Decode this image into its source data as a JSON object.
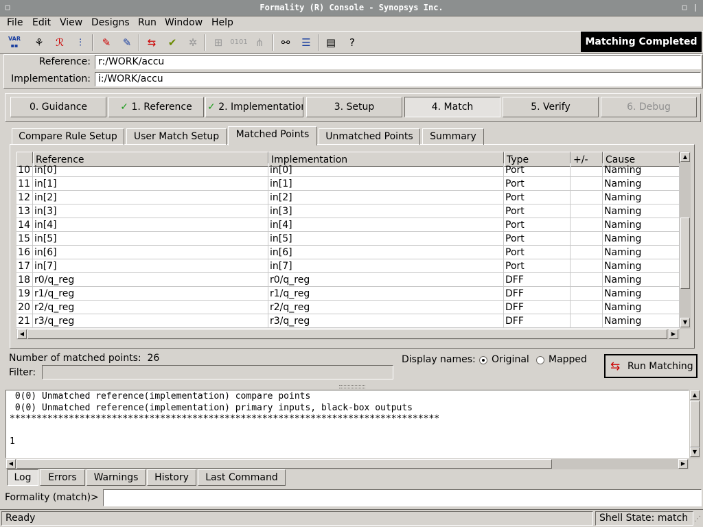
{
  "window": {
    "title": "Formality (R) Console - Synopsys Inc."
  },
  "menu": [
    "File",
    "Edit",
    "View",
    "Designs",
    "Run",
    "Window",
    "Help"
  ],
  "toolbar": {
    "icons": [
      "var-icon",
      "ref-tree-icon",
      "ref-design-icon",
      "impl-tree-icon",
      "erase-ref-icon",
      "erase-impl-icon",
      "match-icon",
      "verify-icon",
      "debug-icon",
      "schematic-icon",
      "binary-icon",
      "cone-icon",
      "find-icon",
      "list-icon",
      "report-icon",
      "help-icon"
    ],
    "var_label": "VAR",
    "status": "Matching Completed"
  },
  "fields": {
    "reference_label": "Reference:",
    "reference_value": "r:/WORK/accu",
    "implementation_label": "Implementation:",
    "implementation_value": "i:/WORK/accu"
  },
  "steps": [
    {
      "label": "0. Guidance",
      "state": "normal"
    },
    {
      "label": "1. Reference",
      "state": "done"
    },
    {
      "label": "2. Implementation",
      "state": "done"
    },
    {
      "label": "3. Setup",
      "state": "normal"
    },
    {
      "label": "4. Match",
      "state": "active"
    },
    {
      "label": "5. Verify",
      "state": "normal"
    },
    {
      "label": "6. Debug",
      "state": "disabled"
    }
  ],
  "tabs": [
    "Compare Rule Setup",
    "User Match Setup",
    "Matched Points",
    "Unmatched Points",
    "Summary"
  ],
  "active_tab": "Matched Points",
  "table": {
    "headers": [
      "Reference",
      "Implementation",
      "Type",
      "+/-",
      "Cause"
    ],
    "rows": [
      {
        "num": "10",
        "ref": "in[0]",
        "impl": "in[0]",
        "type": "Port",
        "pm": "",
        "cause": "Naming"
      },
      {
        "num": "11",
        "ref": "in[1]",
        "impl": "in[1]",
        "type": "Port",
        "pm": "",
        "cause": "Naming"
      },
      {
        "num": "12",
        "ref": "in[2]",
        "impl": "in[2]",
        "type": "Port",
        "pm": "",
        "cause": "Naming"
      },
      {
        "num": "13",
        "ref": "in[3]",
        "impl": "in[3]",
        "type": "Port",
        "pm": "",
        "cause": "Naming"
      },
      {
        "num": "14",
        "ref": "in[4]",
        "impl": "in[4]",
        "type": "Port",
        "pm": "",
        "cause": "Naming"
      },
      {
        "num": "15",
        "ref": "in[5]",
        "impl": "in[5]",
        "type": "Port",
        "pm": "",
        "cause": "Naming"
      },
      {
        "num": "16",
        "ref": "in[6]",
        "impl": "in[6]",
        "type": "Port",
        "pm": "",
        "cause": "Naming"
      },
      {
        "num": "17",
        "ref": "in[7]",
        "impl": "in[7]",
        "type": "Port",
        "pm": "",
        "cause": "Naming"
      },
      {
        "num": "18",
        "ref": "r0/q_reg",
        "impl": "r0/q_reg",
        "type": "DFF",
        "pm": "",
        "cause": "Naming"
      },
      {
        "num": "19",
        "ref": "r1/q_reg",
        "impl": "r1/q_reg",
        "type": "DFF",
        "pm": "",
        "cause": "Naming"
      },
      {
        "num": "20",
        "ref": "r2/q_reg",
        "impl": "r2/q_reg",
        "type": "DFF",
        "pm": "",
        "cause": "Naming"
      },
      {
        "num": "21",
        "ref": "r3/q_reg",
        "impl": "r3/q_reg",
        "type": "DFF",
        "pm": "",
        "cause": "Naming"
      }
    ]
  },
  "matched": {
    "label": "Number of matched points:",
    "count": "26"
  },
  "filter": {
    "label": "Filter:",
    "value": ""
  },
  "display_names": {
    "label": "Display names:",
    "options": [
      "Original",
      "Mapped"
    ],
    "selected": "Original"
  },
  "run_button": "Run Matching",
  "log_lines": [
    " 0(0) Unmatched reference(implementation) compare points",
    " 0(0) Unmatched reference(implementation) primary inputs, black-box outputs",
    "********************************************************************************",
    "",
    "1"
  ],
  "bottom_tabs": [
    "Log",
    "Errors",
    "Warnings",
    "History",
    "Last Command"
  ],
  "active_bottom_tab": "Log",
  "command": {
    "prompt": "Formality (match)>",
    "value": ""
  },
  "statusbar": {
    "left": "Ready",
    "right": "Shell State: match"
  }
}
